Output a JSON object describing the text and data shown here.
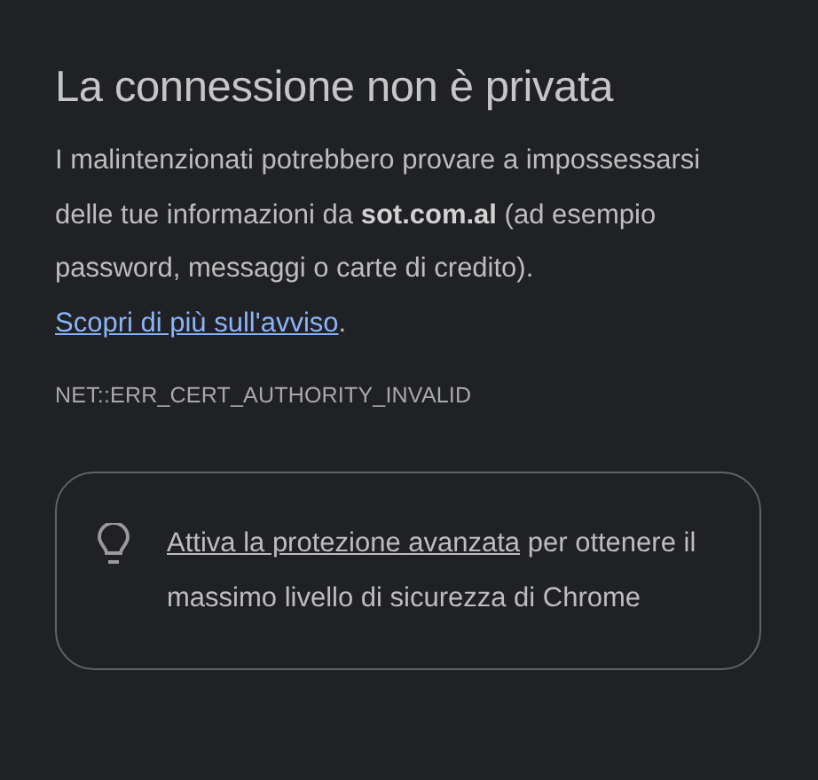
{
  "title": "La connessione non è privata",
  "message": {
    "text": "I malintenzionati potrebbero provare a impossessarsi delle tue informazioni da **sot.com.al** (ad esempio password, messaggi o carte di credito).",
    "link": "Scopri di più sull'avviso",
    "after": "."
  },
  "error_code": "NET::ERR_CERT_AUTHORITY_INVALID",
  "protection_card": {
    "link": "Attiva la protezione avanzata",
    "text": "per ottenere il massimo livello di sicurezza di Chrome"
  }
}
